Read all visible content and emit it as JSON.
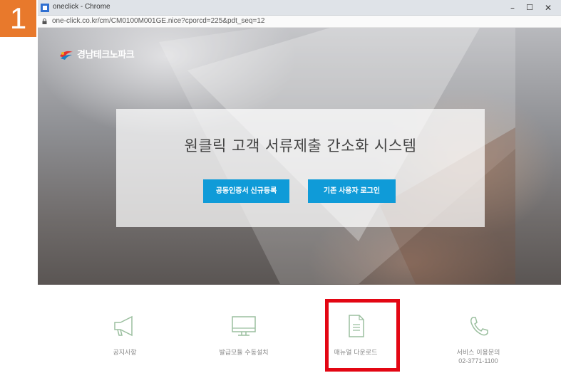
{
  "step": {
    "number": "1",
    "color": "#e8792c"
  },
  "browser": {
    "window_title": "oneclick - Chrome",
    "url": "one-click.co.kr/cm/CM0100M001GE.nice?cporcd=225&pdt_seq=12",
    "controls": {
      "minimize": "–",
      "maximize": "☐",
      "close": "✕"
    }
  },
  "site": {
    "logo_text": "경남테크노파크",
    "hero_title": "원클릭 고객 서류제출 간소화 시스템",
    "buttons": {
      "register": "공동인증서 신규등록",
      "login": "기존 사용자 로그인"
    },
    "accent_color": "#0f9bd8"
  },
  "menu": {
    "notice": {
      "label": "공지사항",
      "icon": "megaphone-icon"
    },
    "install": {
      "label": "발급모듈 수동설치",
      "icon": "monitor-icon"
    },
    "manual": {
      "label": "매뉴얼 다운로드",
      "icon": "document-icon"
    },
    "contact": {
      "label": "서비스 이용문의",
      "phone": "02-3771-1100",
      "icon": "phone-icon"
    }
  },
  "highlight_color": "#e30613"
}
